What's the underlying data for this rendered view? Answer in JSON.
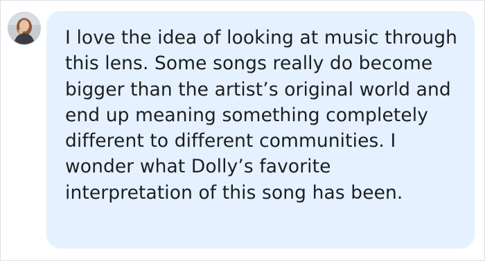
{
  "comment": {
    "avatar_icon": "user-avatar-photo",
    "text": "I love the idea of looking at music through this lens. Some songs really do become bigger than the artist’s original world and end up meaning something completely different to different communities. I wonder what Dolly’s favorite interpretation of this song has been."
  },
  "colors": {
    "bubble_background": "#e5f1ff",
    "text": "#1c1e21",
    "page_background": "#ffffff"
  }
}
